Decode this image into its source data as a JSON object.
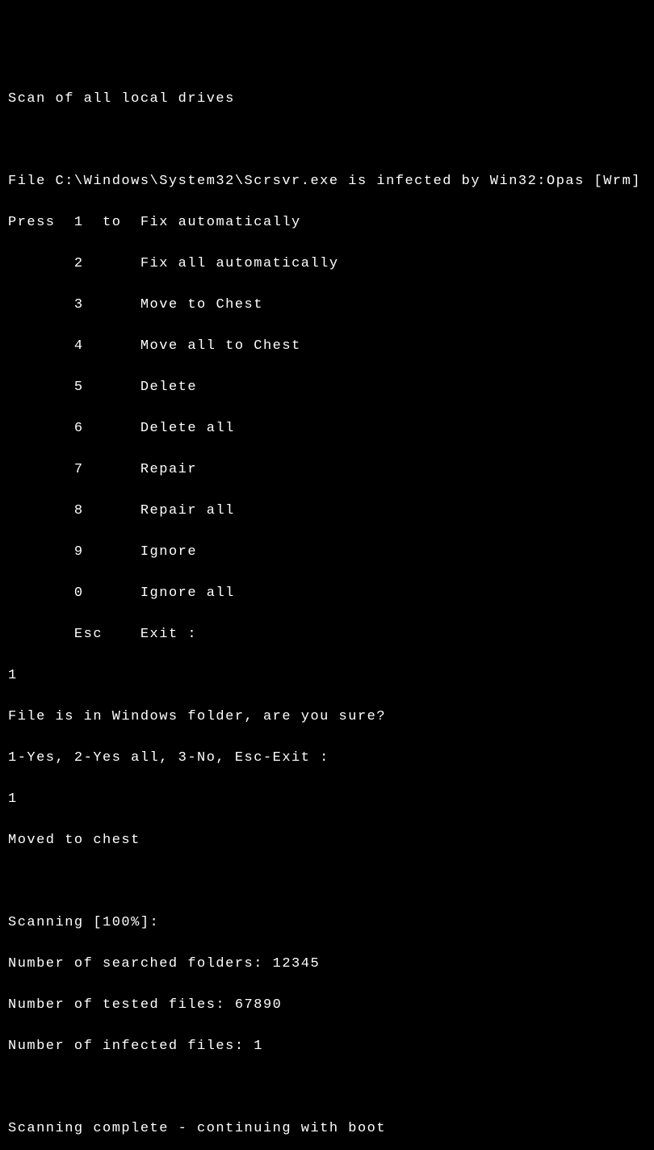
{
  "title": "Scan of all local drives",
  "infection_line": "File C:\\Windows\\System32\\Scrsvr.exe is infected by Win32:Opas [Wrm]",
  "menu_prefix": "Press  1  to  ",
  "menu": {
    "opt1": "Fix automatically",
    "opt2": "Fix all automatically",
    "opt3": "Move to Chest",
    "opt4": "Move all to Chest",
    "opt5": "Delete",
    "opt6": "Delete all",
    "opt7": "Repair",
    "opt8": "Repair all",
    "opt9": "Ignore",
    "opt0": "Ignore all",
    "esc": "Exit :"
  },
  "menu_keys": {
    "k2": "2",
    "k3": "3",
    "k4": "4",
    "k5": "5",
    "k6": "6",
    "k7": "7",
    "k8": "8",
    "k9": "9",
    "k0": "0",
    "esc": "Esc"
  },
  "first_input": "1",
  "confirm_prompt": "File is in Windows folder, are you sure?",
  "confirm_options": "1-Yes, 2-Yes all, 3-No, Esc-Exit :",
  "second_input": "1",
  "result": "Moved to chest",
  "scanning_progress": "Scanning [100%]:",
  "stats": {
    "folders_label": "Number of searched folders: ",
    "folders_value": "12345",
    "tested_label": "Number of tested files: ",
    "tested_value": "67890",
    "infected_label": "Number of infected files: ",
    "infected_value": "1"
  },
  "completion": "Scanning complete - continuing with boot"
}
